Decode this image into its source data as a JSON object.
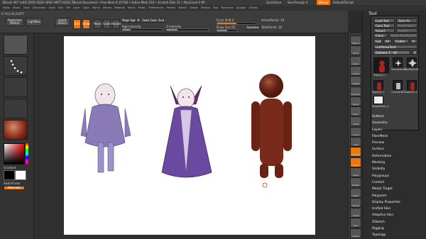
{
  "titlebar": {
    "text": "ZBrush 4R7 [x64] [ROO-SQSF-QRSF-HKTT-VLRQ] ZBrush Document  • Free Mem 9.157GB • Active Mem 519 • Scratch Disk 31 • PolyCount 0 KP",
    "quicksave": "QuickSave",
    "seethrough": "See-through 0",
    "menus": "Menus",
    "defaultzscript": "DefaultZScript"
  },
  "menubar": {
    "items": [
      "Alpha",
      "Brush",
      "Color",
      "Document",
      "Draw",
      "Edit",
      "File",
      "Layer",
      "Light",
      "Macro",
      "Marker",
      "Material",
      "Movie",
      "Picker",
      "Preferences",
      "Render",
      "Stencil",
      "Stroke",
      "Texture",
      "Tool",
      "Transform",
      "Zplugin",
      "Zscript"
    ]
  },
  "coords": "0.74,0.41,0.877",
  "toptool": {
    "projection_master": "Projection Master",
    "lightbox": "LightBox",
    "quick_sketch": "Quick Sketch",
    "edit": "Edit",
    "draw": "Draw",
    "move": "Move",
    "scale": "Scale",
    "rotate": "Rotate",
    "mrgb": "Mrgb",
    "rgb": "Rgb",
    "m": "M",
    "zadd": "Zadd",
    "zsub": "Zsub",
    "zcut": "Zcut",
    "rgb_intensity": "Rgb Intensity",
    "z_intensity": "Z Intensity",
    "focal_shift_label": "Focal Shift",
    "focal_shift_value": "0",
    "draw_size_label": "Draw Size",
    "draw_size_value": "65",
    "dynamic": "Dynamic",
    "active_points": "ActivePoints: 18",
    "total_points": "TotalPoints: 18"
  },
  "leftshelf": {
    "gradient": "Gradient",
    "switchcolor": "SwitchColor",
    "alternate": "Alternate"
  },
  "rightshelf": {
    "items": [
      "SPix 3",
      "Scroll",
      "Zoom",
      "Actual",
      "AAHalf",
      "Dynamic",
      "Persp",
      "Floor",
      "Local",
      "L.Sym",
      "XYZ",
      "Frame",
      "Move",
      "Scale",
      "Rotate",
      "PolyF",
      "Transp",
      "Ghost",
      "Solo",
      "Xpose"
    ]
  },
  "tray": {
    "title": "Tool",
    "load_tool": "Load Tool",
    "save_as": "Save As",
    "copy_tool": "Copy Tool",
    "paste_tool": "Paste Tool",
    "import": "Import",
    "export": "Export",
    "clone": "Clone",
    "make_polymesh": "Make PolyMesh3D",
    "goz": "GoZ",
    "all": "All",
    "visible": "Visible",
    "r": "R",
    "lightbox_tools": "Lightbox▸Tools",
    "current_tool": "Zsphere_1 . 48",
    "r2": "R",
    "tools": [
      {
        "name": "Zsphere_1"
      },
      {
        "name": "SimpleBrush"
      },
      {
        "name": "PolyMesh3D"
      },
      {
        "name": "Zsphere_1"
      },
      {
        "name": "Cylinder3D"
      },
      {
        "name": "Zsphere_1"
      },
      {
        "name": "ImagePlane_2"
      }
    ],
    "menu": [
      "Subtool",
      "Geometry",
      "Layers",
      "FiberMesh",
      "Preview",
      "Surface",
      "Deformation",
      "Masking",
      "Visibility",
      "Polygroups",
      "Contact",
      "Morph Target",
      "Polypaint",
      "Display Properties",
      "Unified Skin",
      "Adaptive Skin",
      "ZSketch",
      "Rigging",
      "Topology"
    ]
  },
  "colors": {
    "accent": "#e8780f",
    "ui_bg": "#2b2b2b"
  }
}
